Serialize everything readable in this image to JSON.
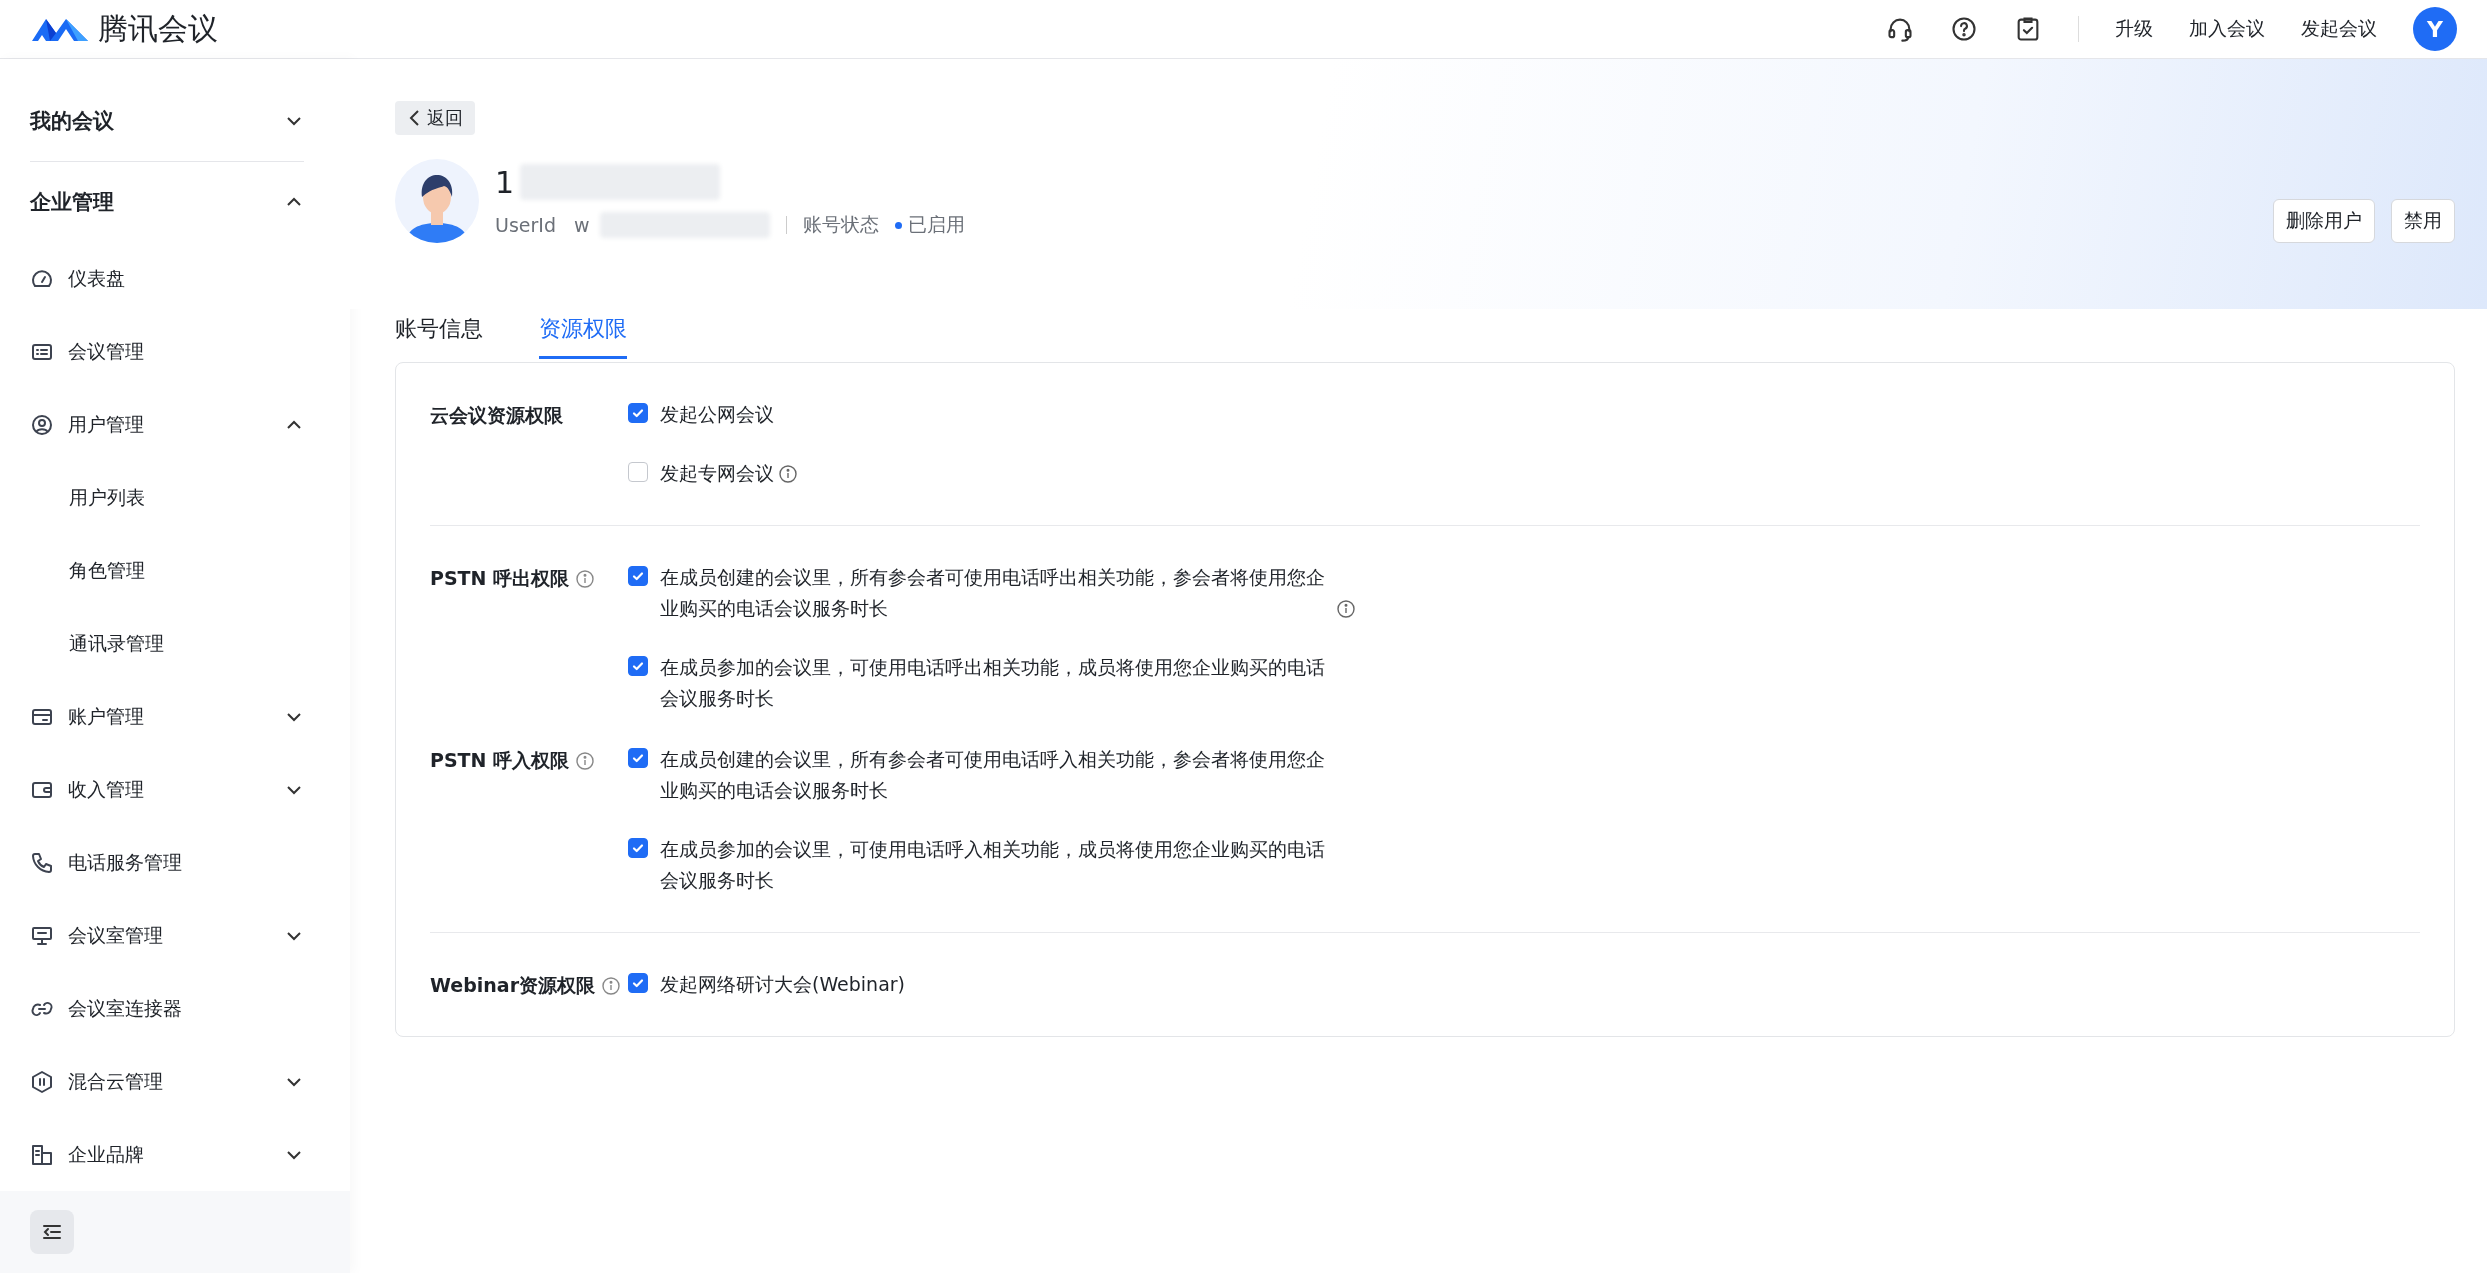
{
  "header": {
    "logo_text": "腾讯会议",
    "links": [
      "升级",
      "加入会议",
      "发起会议"
    ],
    "avatar_letter": "Y"
  },
  "sidebar": {
    "sections": [
      {
        "label": "我的会议",
        "expanded": false
      },
      {
        "label": "企业管理",
        "expanded": true,
        "items": [
          {
            "label": "仪表盘"
          },
          {
            "label": "会议管理"
          },
          {
            "label": "用户管理",
            "expanded": true,
            "children": [
              {
                "label": "用户列表"
              },
              {
                "label": "角色管理"
              },
              {
                "label": "通讯录管理"
              }
            ]
          },
          {
            "label": "账户管理",
            "expanded": false
          },
          {
            "label": "收入管理",
            "expanded": false
          },
          {
            "label": "电话服务管理"
          },
          {
            "label": "会议室管理",
            "expanded": false
          },
          {
            "label": "会议室连接器"
          },
          {
            "label": "混合云管理",
            "expanded": false
          },
          {
            "label": "企业品牌",
            "expanded": false
          }
        ]
      }
    ]
  },
  "back_button": "返回",
  "profile": {
    "name": "1",
    "userid_label": "UserId",
    "userid": "w",
    "status_label": "账号状态",
    "status": "已启用",
    "enabled": true
  },
  "actions": [
    "删除用户",
    "禁用"
  ],
  "tabs": [
    {
      "label": "账号信息",
      "selected": false
    },
    {
      "label": "资源权限",
      "selected": true
    }
  ],
  "permissions": {
    "sections": [
      {
        "groups": [
          {
            "label": "云会议资源权限",
            "info": false,
            "options": [
              {
                "text": "发起公网会议",
                "checked": true,
                "info": false
              },
              {
                "text": "发起专网会议",
                "checked": false,
                "info": true
              }
            ]
          }
        ]
      },
      {
        "groups": [
          {
            "label": "PSTN 呼出权限",
            "info": true,
            "options": [
              {
                "text": "在成员创建的会议里，所有参会者可使用电话呼出相关功能，参会者将使用您企业购买的电话会议服务时长",
                "checked": true,
                "info": true
              },
              {
                "text": "在成员参加的会议里，可使用电话呼出相关功能，成员将使用您企业购买的电话会议服务时长",
                "checked": true,
                "info": false
              }
            ]
          },
          {
            "label": "PSTN 呼入权限",
            "info": true,
            "options": [
              {
                "text": "在成员创建的会议里，所有参会者可使用电话呼入相关功能，参会者将使用您企业购买的电话会议服务时长",
                "checked": true,
                "info": false
              },
              {
                "text": "在成员参加的会议里，可使用电话呼入相关功能，成员将使用您企业购买的电话会议服务时长",
                "checked": true,
                "info": false
              }
            ]
          }
        ]
      },
      {
        "groups": [
          {
            "label": "Webinar资源权限",
            "info": true,
            "options": [
              {
                "text": "发起网络研讨大会(Webinar)",
                "checked": true,
                "info": false
              }
            ]
          }
        ]
      }
    ]
  }
}
